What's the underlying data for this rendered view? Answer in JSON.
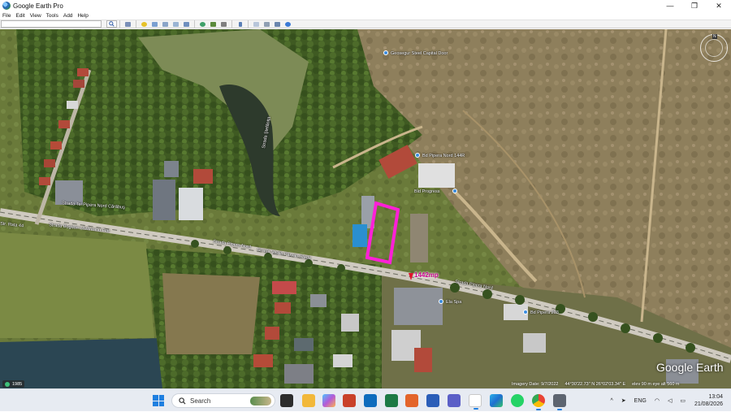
{
  "window": {
    "title": "Google Earth Pro",
    "controls": {
      "minimize": "—",
      "maximize": "❐",
      "close": "✕"
    }
  },
  "menu": [
    "File",
    "Edit",
    "View",
    "Tools",
    "Add",
    "Help"
  ],
  "toolbar": {
    "search_value": "",
    "buttons": [
      "sidebar-icon",
      "placemark-icon",
      "polygon-icon",
      "path-icon",
      "image-overlay-icon",
      "record-tour-icon",
      "historical-imagery-icon",
      "sun-icon",
      "planets-icon",
      "ruler-icon",
      "email-icon",
      "print-icon",
      "save-image-icon",
      "google-maps-icon"
    ]
  },
  "map": {
    "labels": [
      "Geosegur Steel Capital Door",
      "Bd Pipera Nord 144R",
      "Strada Ştefăniţa",
      "Strada Tei Pipera Nord Cărăbuş",
      "Strada Bogdan Lăzăreanu Flat",
      "Strada Pipera Nord",
      "Strada Vasile Pârvan Stada",
      "Str. Rata 44",
      "Strada Pipera Nord",
      "Ela Spa",
      "Bd Pipera 203",
      "Bld Progress"
    ],
    "area_label": "1442mp",
    "historical_imagery": "1985",
    "imagery_date": "Imagery Date: 9/7/2022",
    "coordinates": "44°30'22.73\" N    26°02'03.34\" E",
    "eye_alt": "elev 90 m   eye alt  560 m",
    "brand": "Google Earth",
    "compass_north": "N"
  },
  "taskbar": {
    "search_label": "Search",
    "apps": [
      "widgets-icon",
      "file-explorer-icon",
      "copilot-icon",
      "powerpoint-icon",
      "outlook-icon",
      "excel-icon",
      "office-icon",
      "word-icon",
      "teams-icon",
      "notepad-icon",
      "edge-icon",
      "whatsapp-icon",
      "chrome-icon",
      "calculator-icon"
    ],
    "tray": {
      "chevron": "^",
      "language": "ENG",
      "time": "13:04",
      "date": "21/08/2026"
    }
  },
  "colors": {
    "polygon": "#ff1fd8",
    "pin": "#e0142c",
    "accent": "#1f7fe0"
  }
}
